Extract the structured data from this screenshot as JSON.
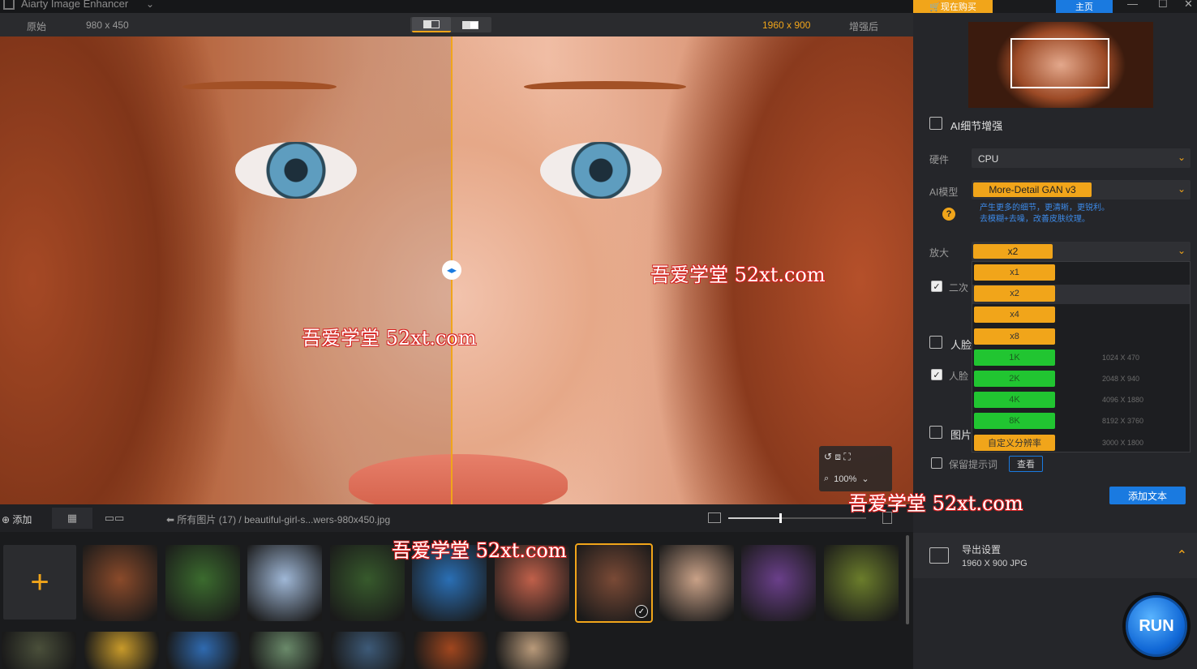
{
  "app": {
    "title": "Aiarty Image Enhancer"
  },
  "viewbar": {
    "original_label": "原始",
    "original_size": "980 x 450",
    "new_size": "1960 x 900",
    "after_label": "增强后"
  },
  "canvas": {
    "watermarks": [
      "吾爱学堂 52xt.com",
      "吾爱学堂 52xt.com",
      "吾爱学堂 52xt.com",
      "吾爱学堂 52xt.com"
    ],
    "zoom": "100%"
  },
  "gallery": {
    "add_label": "添加",
    "breadcrumb": "所有图片 (17)  /  beautiful-girl-s...wers-980x450.jpg",
    "thumbnail_colors": [
      "#8a4a2a",
      "#3b6b2e",
      "#9fb7d6",
      "#375a2c",
      "#2a6fb5",
      "#c0604a",
      "#7a4a36",
      "#c9a187",
      "#6a3f8a",
      "#6b7d2b",
      "#4a4f3a",
      "#c89a2a",
      "#2f6ab0",
      "#6a8a6a",
      "#3d5a78",
      "#a0461e",
      "#b99a7a"
    ]
  },
  "panel": {
    "buy_label": "现在购买",
    "home_label": "主页",
    "section_title": "AI细节增强",
    "hardware_label": "硬件",
    "hardware_value": "CPU",
    "model_label": "AI模型",
    "model_value": "More-Detail GAN  v3",
    "model_desc_1": "产生更多的细节，更清晰，更锐利。",
    "model_desc_2": "去模糊+去噪，改善皮肤纹理。",
    "scale_label": "放大",
    "scale_value": "x2",
    "second_label": "二次",
    "face_label": "人脸",
    "face_check_label": "人脸",
    "img_label": "图片",
    "keep_label": "保留提示词",
    "view_label": "查看",
    "add_text_label": "添加文本",
    "export_title": "导出设置",
    "export_value": "1960 X 900  JPG",
    "run_label": "RUN",
    "scale_options": [
      {
        "label": "x1",
        "res": ""
      },
      {
        "label": "x2",
        "res": ""
      },
      {
        "label": "x4",
        "res": ""
      },
      {
        "label": "x8",
        "res": ""
      },
      {
        "label": "1K",
        "res": "1024 X 470"
      },
      {
        "label": "2K",
        "res": "2048 X 940"
      },
      {
        "label": "4K",
        "res": "4096 X 1880"
      },
      {
        "label": "8K",
        "res": "8192 X 3760"
      },
      {
        "label": "自定义分辨率",
        "res": "3000 X 1800"
      }
    ]
  }
}
